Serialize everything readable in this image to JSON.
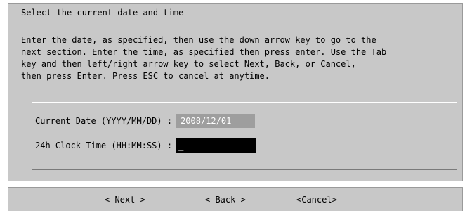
{
  "dialog": {
    "title": "Select the current date and time",
    "instructions": [
      "Enter the date, as specified, then use the down arrow key to go to the",
      "next section. Enter the time, as specified then press enter. Use the Tab",
      "key and then left/right arrow key to select Next, Back, or Cancel,",
      "then press Enter. Press ESC to cancel at anytime."
    ]
  },
  "form": {
    "date_label": "Current Date (YYYY/MM/DD) :",
    "date_value": "2008/12/01",
    "time_label": "24h Clock Time (HH:MM:SS) :",
    "time_value": "_"
  },
  "buttons": {
    "next": "< Next >",
    "back": "< Back >",
    "cancel": "<Cancel>"
  },
  "colors": {
    "panel_background": "#c8c8c8",
    "date_field_background": "#9e9e9e",
    "time_field_background": "#000000"
  }
}
